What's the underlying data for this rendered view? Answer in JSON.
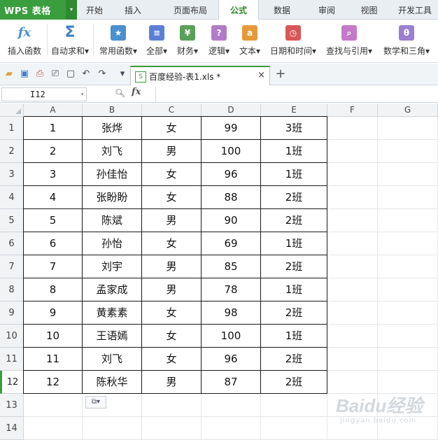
{
  "app": {
    "logo": "WPS 表格",
    "logo_dropdown": "▾"
  },
  "tabs": [
    "开始",
    "插入",
    "页面布局",
    "公式",
    "数据",
    "审阅",
    "视图",
    "开发工具"
  ],
  "active_tab": "公式",
  "ribbon": [
    {
      "label": "插入函数",
      "icon": "fx-icon",
      "glyph": "fx",
      "color": "#4a8fd0"
    },
    {
      "label": "自动求和▾",
      "icon": "sum-icon",
      "glyph": "Σ",
      "color": "#3d7fc8"
    },
    {
      "label": "常用函数▾",
      "icon": "star-book-icon",
      "glyph": "★",
      "color": "#4a8fd0"
    },
    {
      "label": "全部▾",
      "icon": "list-book-icon",
      "glyph": "≡",
      "color": "#5b7fd6"
    },
    {
      "label": "财务▾",
      "icon": "finance-book-icon",
      "glyph": "¥",
      "color": "#5aa05a"
    },
    {
      "label": "逻辑▾",
      "icon": "logic-book-icon",
      "glyph": "?",
      "color": "#b07cc8"
    },
    {
      "label": "文本▾",
      "icon": "text-book-icon",
      "glyph": "a",
      "color": "#e59a3a"
    },
    {
      "label": "日期和时间▾",
      "icon": "clock-book-icon",
      "glyph": "◷",
      "color": "#d95757"
    },
    {
      "label": "查找与引用▾",
      "icon": "search-book-icon",
      "glyph": "⌕",
      "color": "#c47ac8"
    },
    {
      "label": "数学和三角▾",
      "icon": "theta-book-icon",
      "glyph": "θ",
      "color": "#9b7fd0"
    }
  ],
  "quick_access": [
    {
      "name": "open-folder-icon",
      "glyph": "▰"
    },
    {
      "name": "save-icon",
      "glyph": "▣"
    },
    {
      "name": "export-pdf-icon",
      "glyph": "⎙"
    },
    {
      "name": "print-icon",
      "glyph": "⎚"
    },
    {
      "name": "print-preview-icon",
      "glyph": "▢"
    },
    {
      "name": "undo-icon",
      "glyph": "↶"
    },
    {
      "name": "redo-icon",
      "glyph": "↷"
    },
    {
      "name": "more-dropdown-icon",
      "glyph": "▾"
    }
  ],
  "document_tab": {
    "name": "百度经验-表1.xls *",
    "close": "×",
    "new_tab": "+"
  },
  "formula_bar": {
    "name_box": "I12",
    "fx_label": "fx",
    "formula": ""
  },
  "columns": [
    "A",
    "B",
    "C",
    "D",
    "E",
    "F",
    "G"
  ],
  "rows": [
    [
      "1",
      "张烨",
      "女",
      "99",
      "3班"
    ],
    [
      "2",
      "刘飞",
      "男",
      "100",
      "1班"
    ],
    [
      "3",
      "孙佳怡",
      "女",
      "96",
      "1班"
    ],
    [
      "4",
      "张盼盼",
      "女",
      "88",
      "2班"
    ],
    [
      "5",
      "陈斌",
      "男",
      "90",
      "2班"
    ],
    [
      "6",
      "孙怡",
      "女",
      "69",
      "1班"
    ],
    [
      "7",
      "刘宇",
      "男",
      "85",
      "2班"
    ],
    [
      "8",
      "孟家成",
      "男",
      "78",
      "1班"
    ],
    [
      "9",
      "黄素素",
      "女",
      "98",
      "2班"
    ],
    [
      "10",
      "王语嫣",
      "女",
      "100",
      "1班"
    ],
    [
      "11",
      "刘飞",
      "女",
      "96",
      "2班"
    ],
    [
      "12",
      "陈秋华",
      "男",
      "87",
      "2班"
    ]
  ],
  "row_numbers": [
    "1",
    "2",
    "3",
    "4",
    "5",
    "6",
    "7",
    "8",
    "9",
    "10",
    "11",
    "12",
    "13",
    "14"
  ],
  "selected_row": "12",
  "paste_options": "⧉▾",
  "watermark": {
    "line1": "Baidu经验",
    "line2": "jingyan.baidu.com"
  },
  "colors": {
    "brand": "#3a9d3e",
    "active_tab_text": "#2d8a30"
  }
}
